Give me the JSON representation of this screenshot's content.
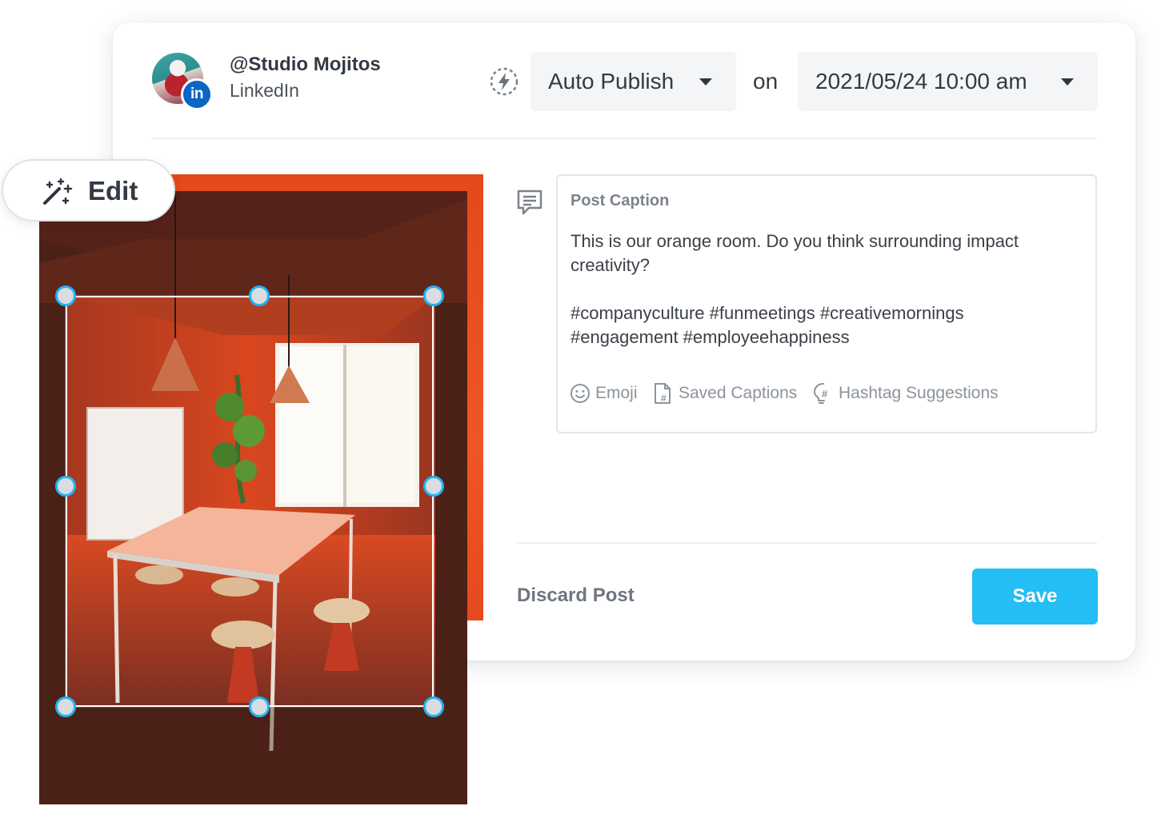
{
  "account": {
    "name": "@Studio Mojitos",
    "network": "LinkedIn",
    "badge": "in",
    "avatar_icon": "profile-avatar",
    "network_color": "#0a66c2"
  },
  "schedule": {
    "mode_icon": "auto-publish-icon",
    "mode": "Auto Publish",
    "connector": "on",
    "datetime": "2021/05/24 10:00 am"
  },
  "editor": {
    "edit_label": "Edit",
    "edit_icon": "magic-wand-icon"
  },
  "caption": {
    "title": "Post Caption",
    "lines": [
      "This is our orange room. Do you think surrounding impact",
      "creativity?",
      "",
      "#companyculture #funmeetings #creativemornings",
      "#engagement #employeehappiness"
    ],
    "tools": [
      {
        "label": "Emoji",
        "icon": "smiley-icon"
      },
      {
        "label": "Saved Captions",
        "icon": "saved-captions-icon"
      },
      {
        "label": "Hashtag Suggestions",
        "icon": "hashtag-bulb-icon"
      }
    ]
  },
  "actions": {
    "discard": "Discard Post",
    "save": "Save"
  },
  "colors": {
    "accent": "#24bdf4",
    "handle_border": "#1fb3f3",
    "room": "#ef5526"
  }
}
